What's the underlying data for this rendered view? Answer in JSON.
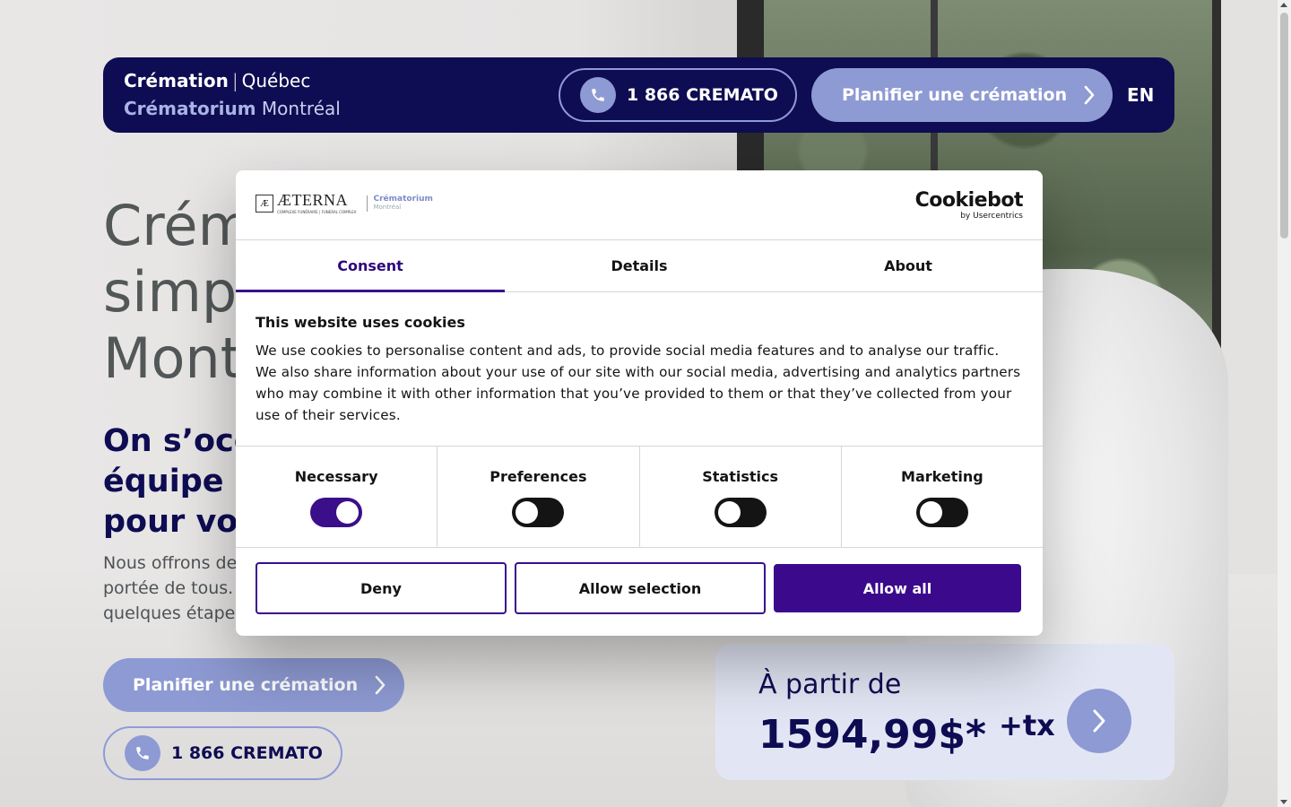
{
  "header": {
    "brand_line1_bold": "Crémation",
    "brand_line1_sep": "|",
    "brand_line1_light": "Québec",
    "brand_line2_bold": "Crématorium",
    "brand_line2_light": "Montréal",
    "phone": "1 866 CREMATO",
    "plan_label": "Planifier une crémation",
    "lang": "EN"
  },
  "hero": {
    "title_lines": [
      "Crém",
      "simpl",
      "Mont"
    ],
    "subtitle_lines": [
      "On s’occ",
      "équipe e",
      "pour vou"
    ],
    "body_lines": [
      "Nous offrons de",
      "portée de tous.",
      "quelques étape"
    ],
    "plan_label": "Planifier une crémation",
    "phone": "1 866 CREMATO"
  },
  "price": {
    "from": "À partir de",
    "amount": "1594,99$*",
    "tax": "+tx"
  },
  "dialog": {
    "aeterna_mark": "Æ",
    "aeterna_name": "ÆTERNA",
    "aeterna_tagline": "COMPLEXE FUNÉRAIRE | FUNERAL COMPLEX",
    "crem_label": "Crématorium",
    "crem_city": "Montréal",
    "cookiebot": "Cookiebot",
    "cookiebot_by": "by Usercentrics",
    "tabs": [
      "Consent",
      "Details",
      "About"
    ],
    "active_tab": "Consent",
    "heading": "This website uses cookies",
    "text": "We use cookies to personalise content and ads, to provide social media features and to analyse our traffic. We also share information about your use of our site with our social media, advertising and analytics partners who may combine it with other information that you’ve provided to them or that they’ve collected from your use of their services.",
    "toggles": [
      {
        "label": "Necessary",
        "on": true
      },
      {
        "label": "Preferences",
        "on": false
      },
      {
        "label": "Statistics",
        "on": false
      },
      {
        "label": "Marketing",
        "on": false
      }
    ],
    "buttons": {
      "deny": "Deny",
      "allow_selection": "Allow selection",
      "allow_all": "Allow all"
    }
  },
  "colors": {
    "navy": "#0e0c52",
    "periwinkle": "#8e9ad3",
    "cookie_purple": "#3b0a8c"
  }
}
